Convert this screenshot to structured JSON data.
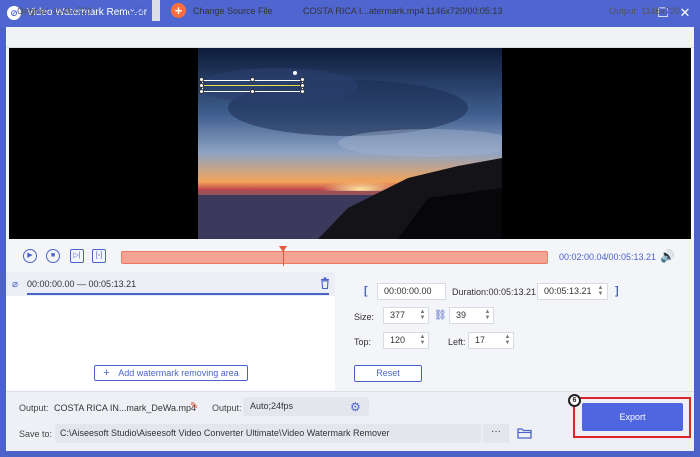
{
  "window": {
    "title": "Video Watermark Remover",
    "controls": {
      "minimize_icon": "maximize-icon",
      "close_icon": "close-icon"
    }
  },
  "infobar": {
    "original": "Original: 1146x720",
    "change_source": "Change Source File",
    "filename": "COSTA RICA I...atermark.mp4",
    "file_info": "1146x720/00:05:13",
    "output": "Output: 1146x720"
  },
  "playback": {
    "current_time": "00:02:00.04",
    "total_time": "/00:05:13.21",
    "progress_fraction": 0.38
  },
  "clip": {
    "time_range": "00:00:00.00 — 00:05:13.21",
    "add_area_label": "Add watermark removing area"
  },
  "settings": {
    "start_time": "00:00:00.00",
    "duration_label": "Duration:00:05:13.21",
    "end_time": "00:05:13.21",
    "size_label": "Size:",
    "width": "377",
    "height": "39",
    "top_label": "Top:",
    "top": "120",
    "left_label": "Left:",
    "left": "17",
    "reset_label": "Reset"
  },
  "bottom": {
    "output_label": "Output:",
    "output_file": "COSTA RICA IN...mark_DeWa.mp4",
    "format_label": "Output:",
    "format_value": "Auto;24fps",
    "save_label": "Save to:",
    "save_path": "C:\\Aiseesoft Studio\\Aiseesoft Video Converter Ultimate\\Video Watermark Remover",
    "browse_label": "···",
    "export_label": "Export",
    "step_number": "6"
  },
  "colors": {
    "accent": "#4b63c9",
    "timeline": "#f5a494",
    "highlight": "#e0262a",
    "orange": "#ff6f3d"
  }
}
